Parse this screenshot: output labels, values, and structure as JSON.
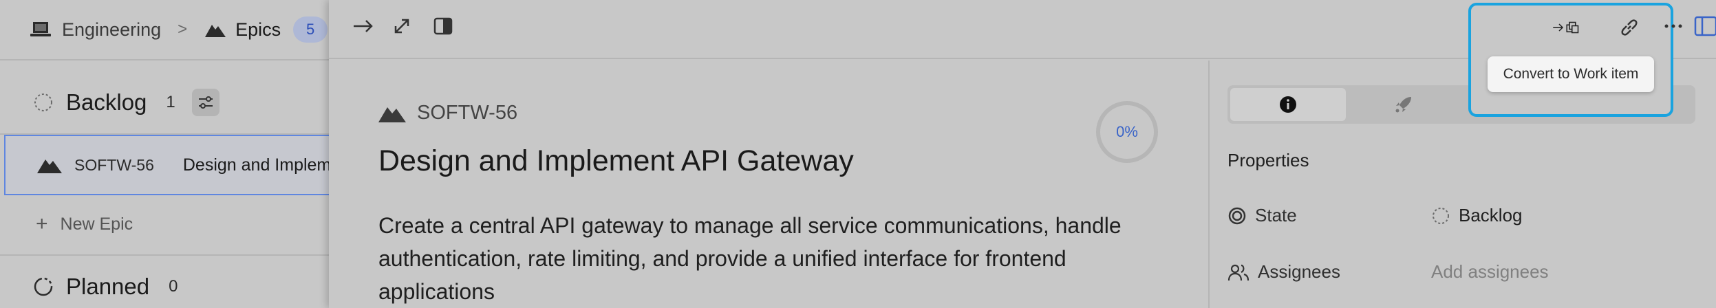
{
  "breadcrumb": {
    "workspace": "Engineering",
    "separator": ">",
    "current": "Epics",
    "count": "5"
  },
  "groups": [
    {
      "label": "Backlog",
      "count": "1"
    },
    {
      "label": "Planned",
      "count": "0"
    }
  ],
  "list_row": {
    "id": "SOFTW-56",
    "title": "Design and Implement API Gateway"
  },
  "new_epic_label": "New Epic",
  "epic": {
    "id": "SOFTW-56",
    "title": "Design and Implement API Gateway",
    "description": "Create a central API gateway to manage all service communications, handle authentication, rate limiting, and provide a unified interface for frontend applications",
    "progress": "0%",
    "progress_fraction": 0
  },
  "tooltip": "Convert to Work item",
  "properties": {
    "heading": "Properties",
    "state_label": "State",
    "state_value": "Backlog",
    "assignees_label": "Assignees",
    "assignees_placeholder": "Add assignees"
  },
  "icons": {
    "workspace": "laptop-icon",
    "epic": "mountain-icon",
    "backlog": "dashed-circle-icon",
    "planned": "partial-circle-icon",
    "filter": "sliders-icon",
    "close_peek": "arrow-right-icon",
    "expand": "expand-icon",
    "side_peek": "panel-icon",
    "convert": "convert-icon",
    "link": "link-icon",
    "more": "ellipsis-icon",
    "info_tab": "info-icon",
    "updates_tab": "rocket-icon",
    "comments_tab": "comment-icon",
    "activity_tab": "activity-icon",
    "state": "state-circle-icon",
    "assignees": "users-icon"
  },
  "colors": {
    "accent": "#3a64c8",
    "highlight": "#1aa3df",
    "selection": "#5f86e0",
    "badge_bg": "#aeb8d6"
  }
}
